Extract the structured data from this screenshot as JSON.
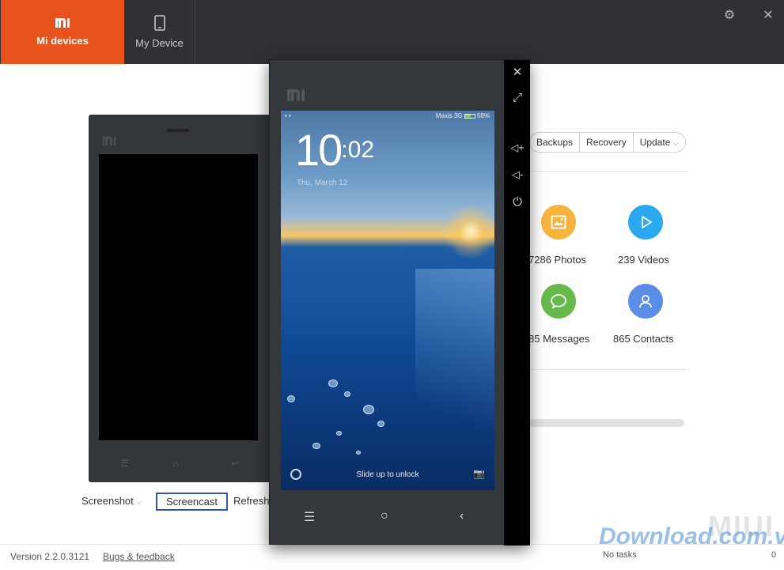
{
  "nav": {
    "mi_devices": "Mi devices",
    "my_device": "My Device"
  },
  "left_actions": {
    "screenshot": "Screenshot",
    "screencast": "Screencast",
    "refresh": "Refresh"
  },
  "tabs": [
    "Backups",
    "Recovery",
    "Update"
  ],
  "stats": {
    "photos": "7286 Photos",
    "videos": "239 Videos",
    "messages": "85 Messages",
    "contacts": "865 Contacts"
  },
  "colors": {
    "accent": "#e8531d",
    "photos": "#f6b33e",
    "videos": "#2aa8f0",
    "messages": "#66b94a",
    "contacts": "#5a8de8",
    "highlight": "#2f55b5"
  },
  "lockscreen": {
    "hour": "10",
    "minute": "02",
    "date": "Thu, March 12",
    "carrier": "Maxis 3G",
    "battery": "58%",
    "unlock_text": "Slide up to unlock"
  },
  "footer": {
    "version": "Version 2.2.0.3121",
    "bugs": "Bugs & feedback",
    "tasks": "No tasks",
    "tasks_count": "0"
  },
  "watermark": {
    "miui": "MIUI",
    "site": "Download.com.vn"
  },
  "icons": {
    "settings": "gear-icon",
    "close": "close-icon",
    "expand": "expand-icon",
    "vol_up": "volume-up-icon",
    "vol_down": "volume-down-icon",
    "power": "power-icon"
  }
}
